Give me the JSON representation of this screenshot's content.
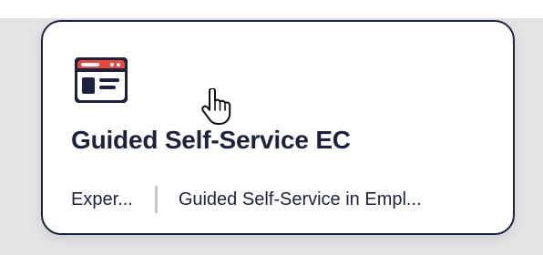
{
  "card": {
    "title": "Guided Self-Service EC",
    "meta": {
      "left": "Exper...",
      "right": "Guided Self-Service in Empl..."
    }
  },
  "icons": {
    "app": "browser-window-icon",
    "cursor": "hand-pointer-icon"
  },
  "colors": {
    "accent": "#e8483a",
    "dark": "#1d2140",
    "divider": "#c4c8cf",
    "background": "#e3e4e6"
  }
}
